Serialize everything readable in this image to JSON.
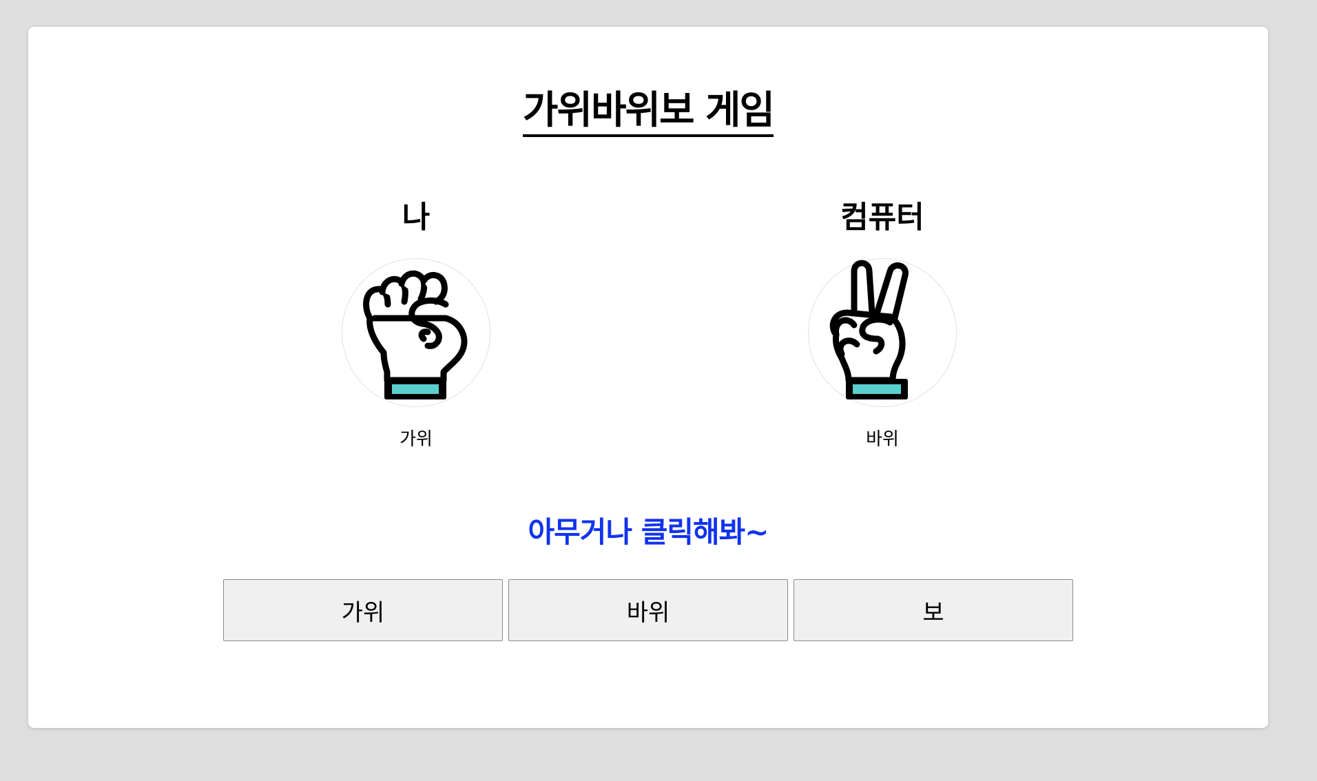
{
  "title": "가위바위보 게임",
  "players": {
    "me": {
      "name": "나",
      "hand_icon": "fist-hand-icon",
      "choice": "가위"
    },
    "computer": {
      "name": "컴퓨터",
      "hand_icon": "victory-hand-icon",
      "choice": "바위"
    }
  },
  "message": "아무거나 클릭해봐~",
  "buttons": {
    "scissors": "가위",
    "rock": "바위",
    "paper": "보"
  },
  "colors": {
    "message": "#1133ee",
    "cuff_accent": "#5bcfd0",
    "background": "#dedede",
    "card": "#ffffff",
    "button_bg": "#f0f0f0"
  }
}
